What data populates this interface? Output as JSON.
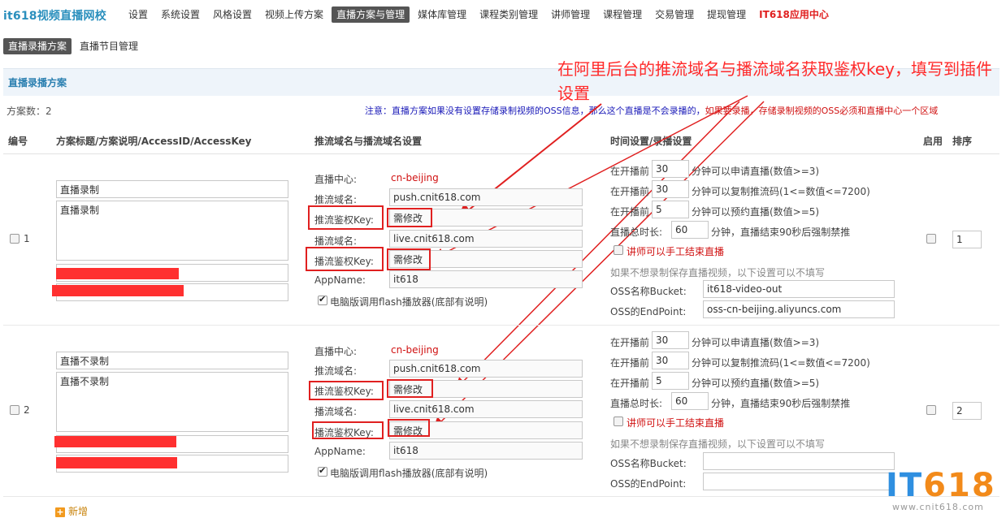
{
  "header": {
    "logo": "it618视频直播网校",
    "nav": [
      "设置",
      "系统设置",
      "风格设置",
      "视频上传方案",
      "直播方案与管理",
      "媒体库管理",
      "课程类别管理",
      "讲师管理",
      "课程管理",
      "交易管理",
      "提现管理",
      "IT618应用中心"
    ],
    "subnav": [
      "直播录播方案",
      "直播节目管理"
    ]
  },
  "section": {
    "title": "直播录播方案",
    "plan_count": "方案数：2",
    "notice_blue": "注意：直播方案如果没有设置存储录制视频的OSS信息，那么这个直播是不会录播的，",
    "notice_red": "如果要录播，存储录制视频的OSS必须和直播中心一个区域"
  },
  "callout": "在阿里后台的推流域名与播流域名获取鉴权key，填写到插件设置",
  "columns": {
    "id": "编号",
    "title": "方案标题/方案说明/AccessID/AccessKey",
    "stream": "推流域名与播流域名设置",
    "time": "时间设置/录播设置",
    "enable": "启用",
    "order": "排序"
  },
  "labels": {
    "center": "直播中心:",
    "push_domain": "推流域名:",
    "push_key": "推流鉴权Key:",
    "play_domain": "播流域名:",
    "play_key": "播流鉴权Key:",
    "appname": "AppName:",
    "flash": "电脑版调用flash播放器(底部有说明)",
    "before1_pre": "在开播前",
    "before1_post": "分钟可以申请直播(数值>=3)",
    "before2_pre": "在开播前",
    "before2_post": "分钟可以复制推流码(1<=数值<=7200)",
    "before3_pre": "在开播前",
    "before3_post": "分钟可以预约直播(数值>=5)",
    "total_pre": "直播总时长:",
    "total_post": "分钟，直播结束90秒后强制禁推",
    "teacher_end": "讲师可以手工结束直播",
    "oss_hint": "如果不想录制保存直播视频，以下设置可以不填写",
    "oss_bucket": "OSS名称Bucket:",
    "oss_endpoint": "OSS的EndPoint:"
  },
  "rows": [
    {
      "id": "1",
      "title": "直播录制",
      "desc": "直播录制",
      "center": "cn-beijing",
      "push_domain": "push.cnit618.com",
      "push_key": "需修改",
      "play_domain": "live.cnit618.com",
      "play_key": "需修改",
      "appname": "it618",
      "before1": "30",
      "before2": "30",
      "before3": "5",
      "total": "60",
      "bucket": "it618-video-out",
      "endpoint": "oss-cn-beijing.aliyuncs.com",
      "order": "1"
    },
    {
      "id": "2",
      "title": "直播不录制",
      "desc": "直播不录制",
      "center": "cn-beijing",
      "push_domain": "push.cnit618.com",
      "push_key": "需修改",
      "play_domain": "live.cnit618.com",
      "play_key": "需修改",
      "appname": "it618",
      "before1": "30",
      "before2": "30",
      "before3": "5",
      "total": "60",
      "bucket": "",
      "endpoint": "",
      "order": "2"
    }
  ],
  "add_label": "新增",
  "watermark": {
    "main_a": "IT",
    "main_b": "618",
    "sub": "www.cnit618.com"
  },
  "colors": {
    "accent": "#2a8fbd",
    "callout": "#ff2a2a",
    "notice": "#1a1ab8",
    "warn": "#d01010"
  }
}
